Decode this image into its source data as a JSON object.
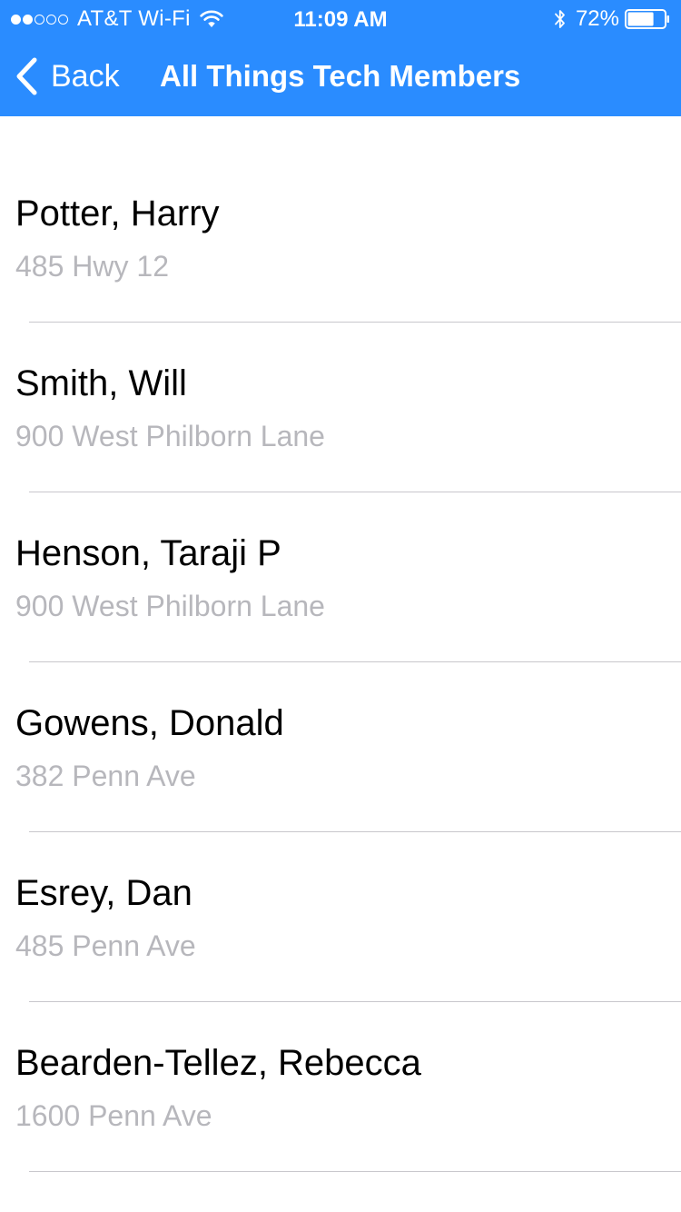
{
  "status_bar": {
    "carrier": "AT&T Wi-Fi",
    "signal_bars_filled": 2,
    "signal_bars_total": 5,
    "time": "11:09 AM",
    "battery_percent": "72%",
    "battery_level": 0.72
  },
  "nav": {
    "back_label": "Back",
    "title": "All Things Tech Members"
  },
  "members": [
    {
      "name": "Potter, Harry",
      "address": "485 Hwy 12"
    },
    {
      "name": "Smith, Will",
      "address": "900 West Philborn Lane"
    },
    {
      "name": "Henson, Taraji P",
      "address": "900 West Philborn Lane"
    },
    {
      "name": "Gowens, Donald",
      "address": "382 Penn Ave"
    },
    {
      "name": "Esrey, Dan",
      "address": "485 Penn Ave"
    },
    {
      "name": "Bearden-Tellez, Rebecca",
      "address": "1600 Penn Ave"
    }
  ],
  "colors": {
    "nav_background": "#2a8cff",
    "secondary_text": "#b7b7bc",
    "separator": "#c8c7cc"
  },
  "icons": [
    "wifi-icon",
    "bluetooth-icon",
    "battery-icon",
    "chevron-left-icon"
  ]
}
